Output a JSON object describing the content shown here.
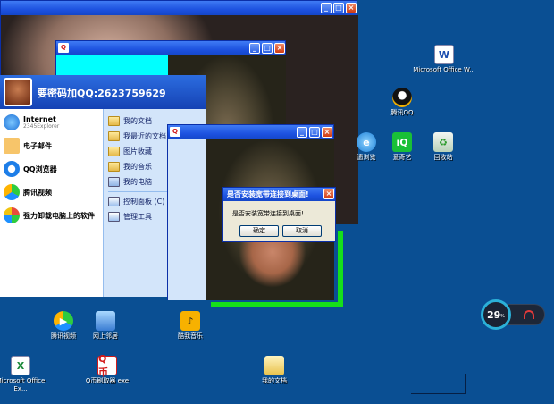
{
  "desktop": {
    "icons": [
      {
        "label": "Microsoft Office W...",
        "icon": "word-doc-icon"
      },
      {
        "label": "腾讯QQ",
        "icon": "qq-penguin-icon"
      },
      {
        "label": "遗浏览",
        "icon": "browser-icon"
      },
      {
        "label": "爱奇艺",
        "icon": "iqiyi-icon"
      },
      {
        "label": "回收站",
        "icon": "recycle-bin-icon"
      },
      {
        "label": "腾讯视频",
        "icon": "tencent-video-icon"
      },
      {
        "label": "网上邻居",
        "icon": "network-places-icon"
      },
      {
        "label": "酷我音乐",
        "icon": "kuwo-music-icon"
      },
      {
        "label": "Microsoft Office Ex...",
        "icon": "excel-icon"
      },
      {
        "label": "Q币刷取器 exe",
        "icon": "qcoin-exe-icon"
      },
      {
        "label": "我的文档",
        "icon": "my-documents-icon"
      }
    ]
  },
  "windows": {
    "app_icon_text": "Q"
  },
  "start_menu": {
    "user": "要密码加QQ:2623759629",
    "left_items": [
      {
        "title": "Internet",
        "sub": "2345Explorer"
      },
      {
        "title": "电子邮件",
        "sub": ""
      },
      {
        "title": "QQ浏览器",
        "sub": ""
      },
      {
        "title": "腾讯视频",
        "sub": ""
      },
      {
        "title": "强力卸载电脑上的软件",
        "sub": ""
      }
    ],
    "right_items": [
      "我的文档",
      "我最近的文档",
      "图片收藏",
      "我的音乐",
      "我的电脑",
      "控制面板 (C)",
      "管理工具"
    ]
  },
  "dialog": {
    "title": "是否安装宽带连接到桌面!",
    "message": "是否安装宽带连接到桌面!",
    "ok": "确定",
    "cancel": "取消"
  },
  "widget": {
    "cpu": "29",
    "unit": "%"
  }
}
